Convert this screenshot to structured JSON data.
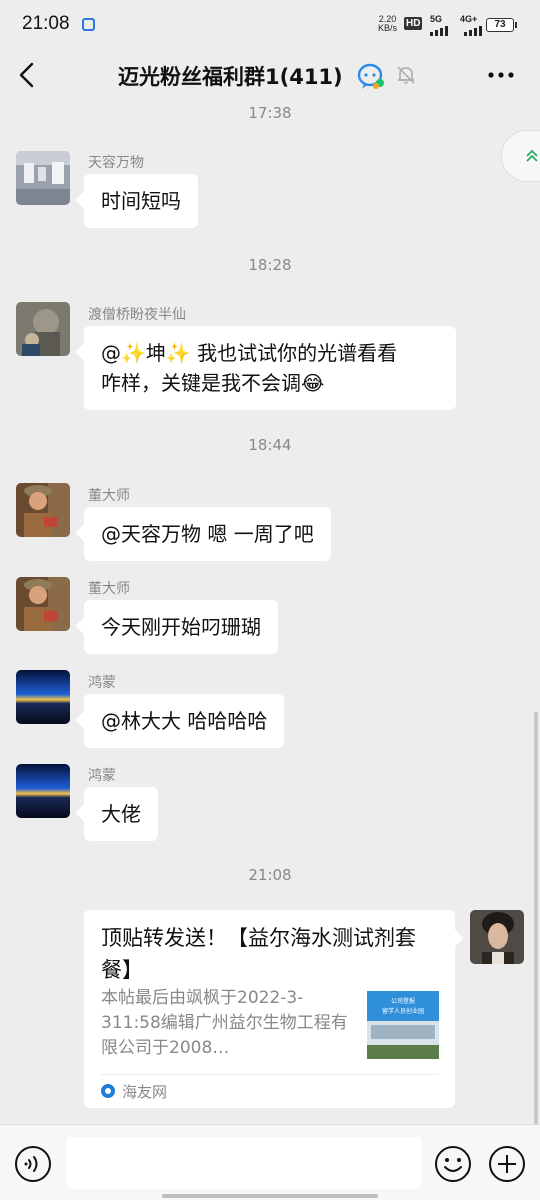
{
  "status_bar": {
    "time": "21:08",
    "speed_value": "2.20",
    "speed_unit": "KB/s",
    "hd_label": "HD",
    "sim1_label": "5G",
    "sim2_label": "4G+",
    "battery": "73"
  },
  "header": {
    "title": "迈光粉丝福利群1(411)"
  },
  "messages": [
    {
      "type": "time",
      "text": "17:38"
    },
    {
      "sender": "天容万物",
      "text": "时间短吗"
    },
    {
      "type": "time",
      "text": "18:28"
    },
    {
      "sender": "渡僧桥盼夜半仙",
      "text_line1_a": "@",
      "spark": "✨",
      "mention": "坤",
      "text_line1_b": " 我也试试你的光谱看看",
      "text_line2": "咋样，关键是我不会调",
      "emoji": "😂"
    },
    {
      "type": "time",
      "text": "18:44"
    },
    {
      "sender": "董大师",
      "text": "@天容万物  嗯 一周了吧"
    },
    {
      "sender": "董大师",
      "text": "今天刚开始叼珊瑚"
    },
    {
      "sender": "鸿蒙",
      "text": "@林大大  哈哈哈哈"
    },
    {
      "sender": "鸿蒙",
      "text": "大佬"
    },
    {
      "type": "time",
      "text": "21:08"
    }
  ],
  "link_card": {
    "title": "顶贴转发送！【益尔海水测试剂套餐】",
    "description": "本帖最后由飒枫于2022-3-311:58编辑广州益尔生物工程有限公司于2008…",
    "source": "海友网",
    "thumb_text_1": "公司登报",
    "thumb_text_2": "留学人员创业园"
  },
  "colors": {
    "background": "#ededed",
    "bubble": "#ffffff",
    "meta_text": "#888888"
  }
}
